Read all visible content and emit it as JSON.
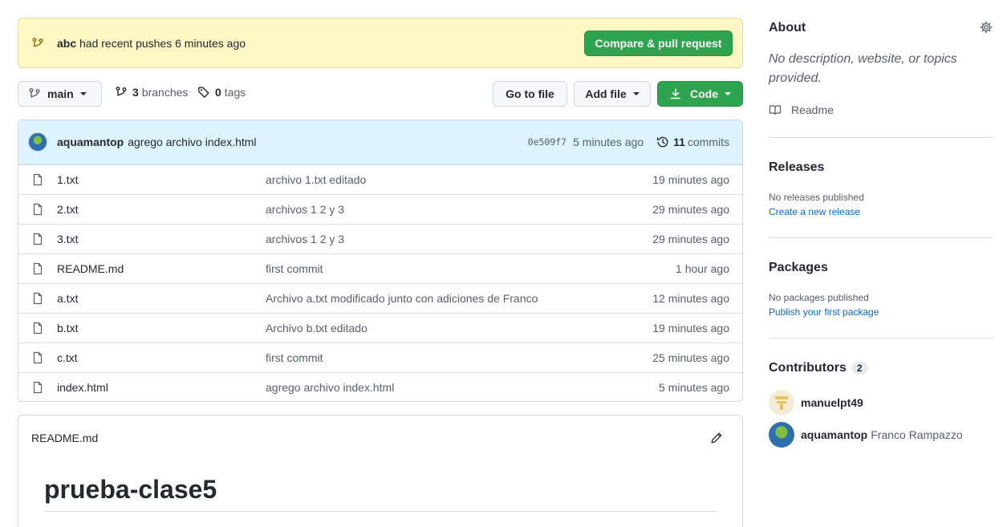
{
  "push_banner": {
    "branch": "abc",
    "message": "had recent pushes 6 minutes ago",
    "button": "Compare & pull request"
  },
  "toolbar": {
    "branch_name": "main",
    "branches_count": "3",
    "branches_label": "branches",
    "tags_count": "0",
    "tags_label": "tags",
    "go_to_file": "Go to file",
    "add_file": "Add file",
    "code": "Code"
  },
  "latest_commit": {
    "author": "aquamantop",
    "message": "agrego archivo index.html",
    "sha": "0e509f7",
    "time": "5 minutes ago",
    "commits_count": "11",
    "commits_label": "commits"
  },
  "files": [
    {
      "name": "1.txt",
      "message": "archivo 1.txt editado",
      "age": "19 minutes ago"
    },
    {
      "name": "2.txt",
      "message": "archivos 1 2 y 3",
      "age": "29 minutes ago"
    },
    {
      "name": "3.txt",
      "message": "archivos 1 2 y 3",
      "age": "29 minutes ago"
    },
    {
      "name": "README.md",
      "message": "first commit",
      "age": "1 hour ago"
    },
    {
      "name": "a.txt",
      "message": "Archivo a.txt modificado junto con adiciones de Franco",
      "age": "12 minutes ago"
    },
    {
      "name": "b.txt",
      "message": "Archivo b.txt editado",
      "age": "19 minutes ago"
    },
    {
      "name": "c.txt",
      "message": "first commit",
      "age": "25 minutes ago"
    },
    {
      "name": "index.html",
      "message": "agrego archivo index.html",
      "age": "5 minutes ago"
    }
  ],
  "readme": {
    "filename": "README.md",
    "heading": "prueba-clase5"
  },
  "sidebar": {
    "about_title": "About",
    "about_desc": "No description, website, or topics provided.",
    "readme_label": "Readme",
    "releases_title": "Releases",
    "releases_empty": "No releases published",
    "releases_link": "Create a new release",
    "packages_title": "Packages",
    "packages_empty": "No packages published",
    "packages_link": "Publish your first package",
    "contributors_title": "Contributors",
    "contributors_count": "2",
    "contributors": [
      {
        "login": "manuelpt49",
        "name": ""
      },
      {
        "login": "aquamantop",
        "name": "Franco Rampazzo"
      }
    ]
  },
  "colors": {
    "accent_green": "#2da44e",
    "link_blue": "#0969da",
    "banner_yellow": "#fff8c5",
    "commit_bar_blue": "#ddf4ff"
  }
}
